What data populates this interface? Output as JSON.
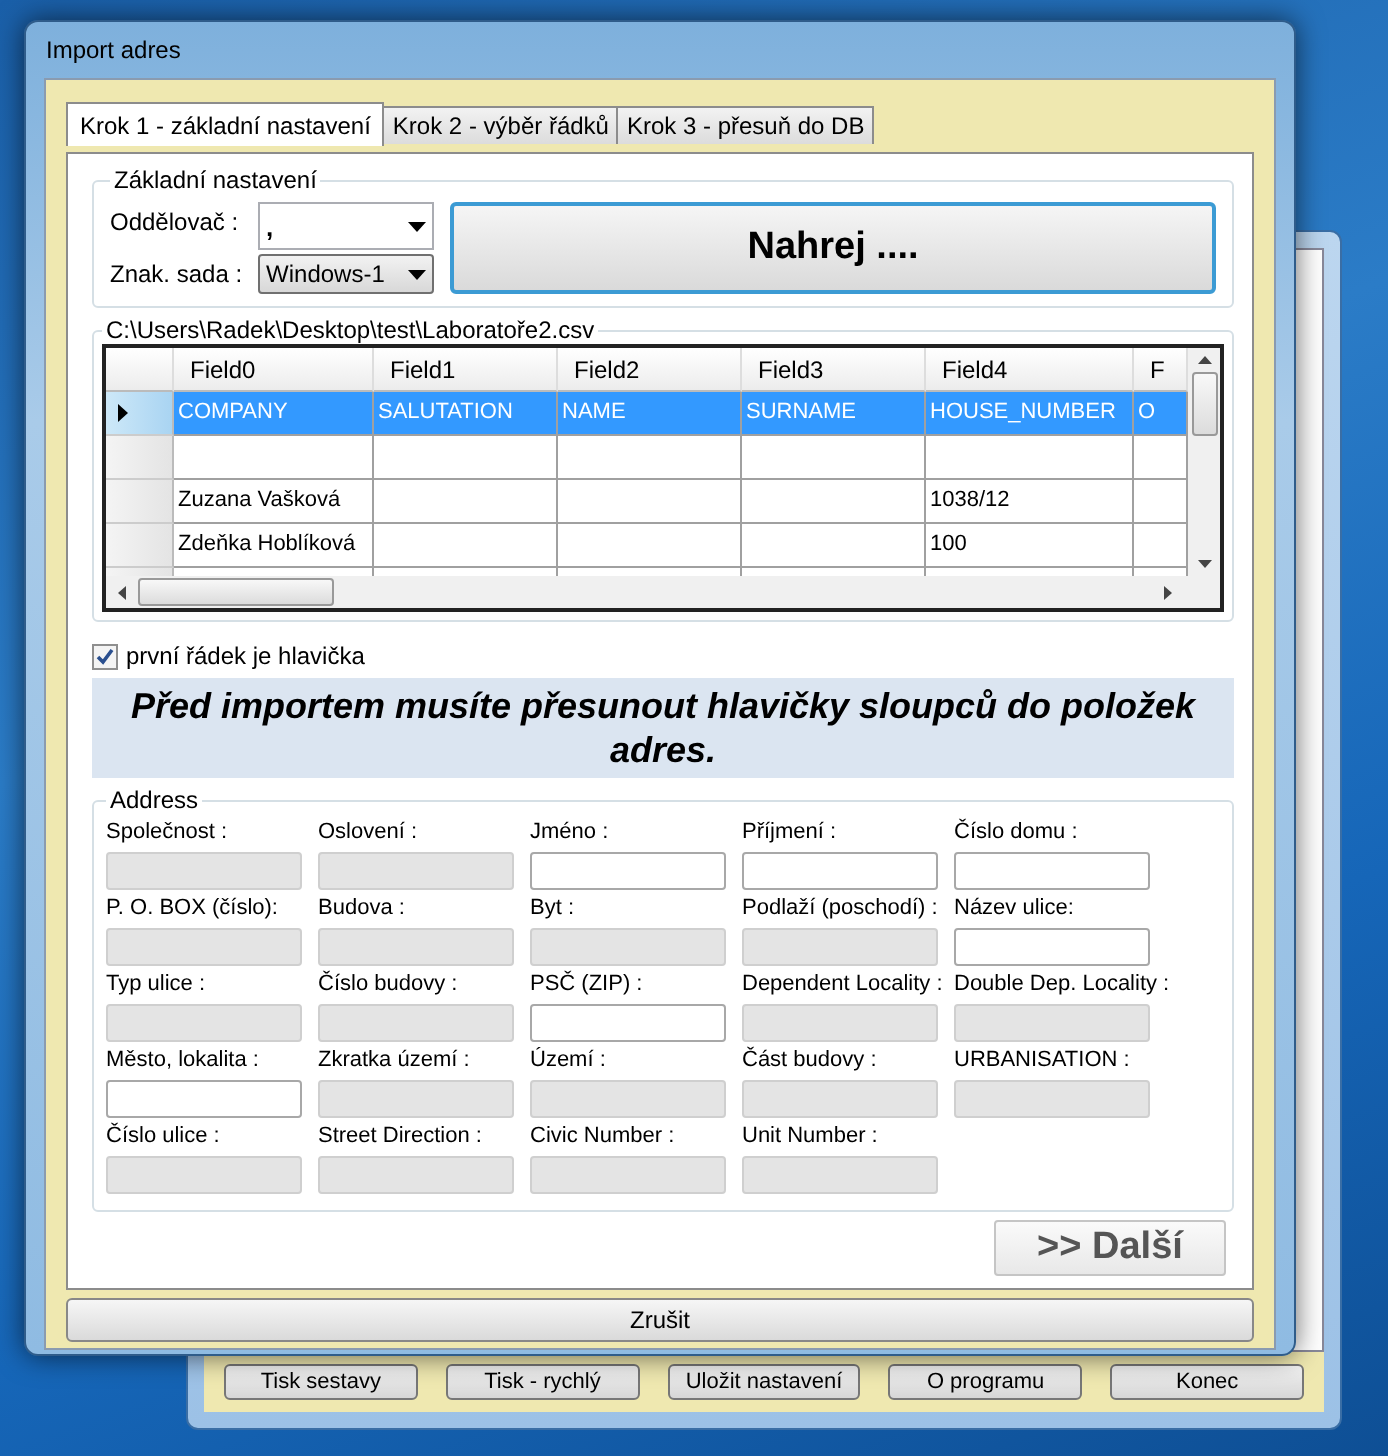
{
  "background_window": {
    "buttons": [
      "Tisk sestavy",
      "Tisk - rychlý",
      "Uložit nastavení",
      "O programu",
      "Konec"
    ]
  },
  "window": {
    "title": "Import adres"
  },
  "tabs": [
    {
      "label": "Krok 1 - základní nastavení",
      "selected": true
    },
    {
      "label": "Krok 2 - výběr řádků",
      "selected": false
    },
    {
      "label": "Krok 3 - přesuň do DB",
      "selected": false
    }
  ],
  "basic_settings": {
    "title": "Základní nastavení",
    "separator_label": "Oddělovač :",
    "separator_value": ",",
    "charset_label": "Znak. sada :",
    "charset_value": "Windows-1",
    "load_button": "Nahrej ...."
  },
  "file_group": {
    "title": "C:\\Users\\Radek\\Desktop\\test\\Laboratoře2.csv",
    "table": {
      "columns": [
        "Field0",
        "Field1",
        "Field2",
        "Field3",
        "Field4",
        "F"
      ],
      "rows": [
        {
          "selected": true,
          "cells": [
            "COMPANY",
            "SALUTATION",
            "NAME",
            "SURNAME",
            "HOUSE_NUMBER",
            "O"
          ]
        },
        {
          "selected": false,
          "cells": []
        },
        {
          "selected": false,
          "cells": [
            "Zuzana Vašková",
            "",
            "",
            "",
            "1038/12",
            ""
          ]
        },
        {
          "selected": false,
          "cells": [
            "Zdeňka Hoblíková",
            "",
            "",
            "",
            "100",
            ""
          ]
        },
        {
          "selected": false,
          "cells": []
        }
      ]
    }
  },
  "header_checkbox": {
    "label": "první řádek je hlavička",
    "checked": true
  },
  "notice": "Před importem musíte přesunout hlavičky sloupců do položek adres.",
  "address": {
    "title": "Address",
    "fields": [
      {
        "label": "Společnost  :",
        "disabled": true
      },
      {
        "label": "Oslovení :",
        "disabled": true
      },
      {
        "label": "Jméno :",
        "disabled": false
      },
      {
        "label": "Příjmení :",
        "disabled": false
      },
      {
        "label": "Číslo domu  :",
        "disabled": false
      },
      {
        "label": "P. O. BOX (číslo):",
        "disabled": true
      },
      {
        "label": "Budova :",
        "disabled": true
      },
      {
        "label": "Byt :",
        "disabled": true
      },
      {
        "label": "Podlaží (poschodí)  :",
        "disabled": true
      },
      {
        "label": "Název ulice:",
        "disabled": false
      },
      {
        "label": "Typ ulice :",
        "disabled": true
      },
      {
        "label": "Číslo budovy :",
        "disabled": true
      },
      {
        "label": "PSČ (ZIP) :",
        "disabled": false
      },
      {
        "label": "Dependent Locality :",
        "disabled": true
      },
      {
        "label": "Double Dep. Locality :",
        "disabled": true
      },
      {
        "label": "Město, lokalita :",
        "disabled": false
      },
      {
        "label": "Zkratka území :",
        "disabled": true
      },
      {
        "label": "Území :",
        "disabled": true
      },
      {
        "label": "Část budovy :",
        "disabled": true
      },
      {
        "label": "URBANISATION :",
        "disabled": true
      },
      {
        "label": "Číslo ulice :",
        "disabled": true
      },
      {
        "label": "Street Direction :",
        "disabled": true
      },
      {
        "label": "Civic Number :",
        "disabled": true
      },
      {
        "label": "Unit Number :",
        "disabled": true
      }
    ]
  },
  "next_button": ">> Další",
  "cancel_button": "Zrušit"
}
